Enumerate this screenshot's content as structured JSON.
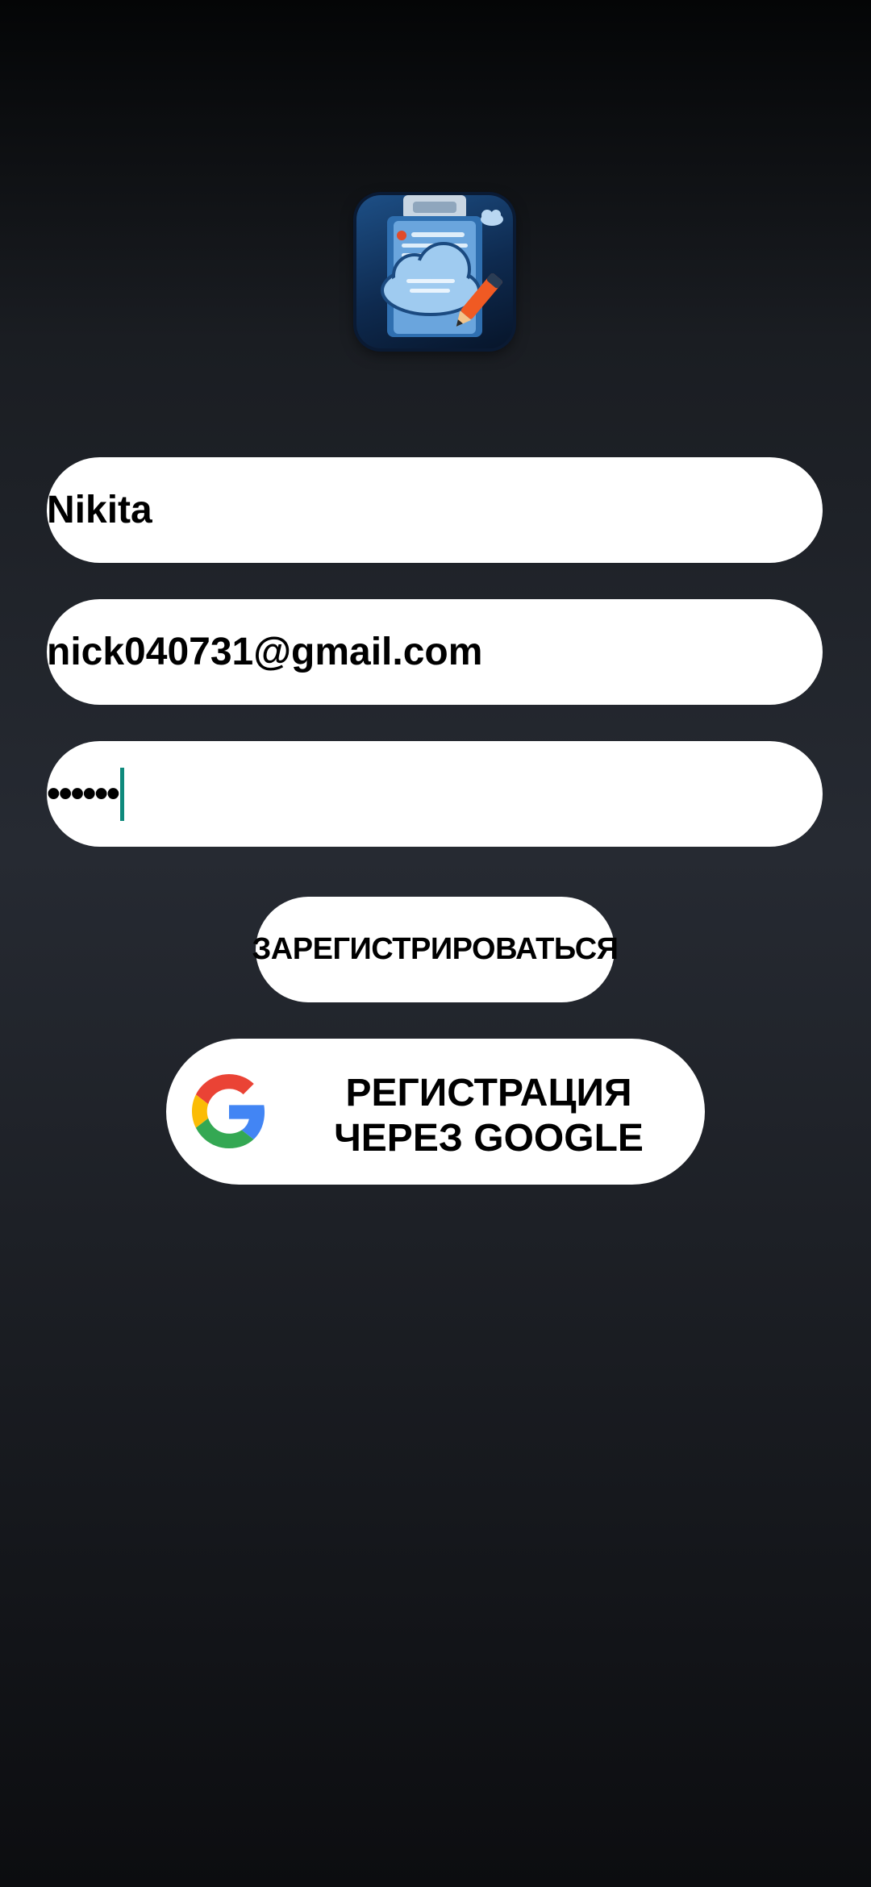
{
  "app": {
    "logo_icon": "cloud-notes-logo-icon"
  },
  "form": {
    "name_value": "Nikita",
    "email_value": "nick040731@gmail.com",
    "password_masked": "••••••"
  },
  "buttons": {
    "register_label": "ЗАРЕГИСТРИРОВАТЬСЯ",
    "google_label_line1": "РЕГИСТРАЦИЯ",
    "google_label_line2": "ЧЕРЕЗ GOOGLE",
    "google_icon": "google-g-icon"
  },
  "colors": {
    "cursor": "#0f8a7c",
    "field_bg": "#ffffff"
  }
}
